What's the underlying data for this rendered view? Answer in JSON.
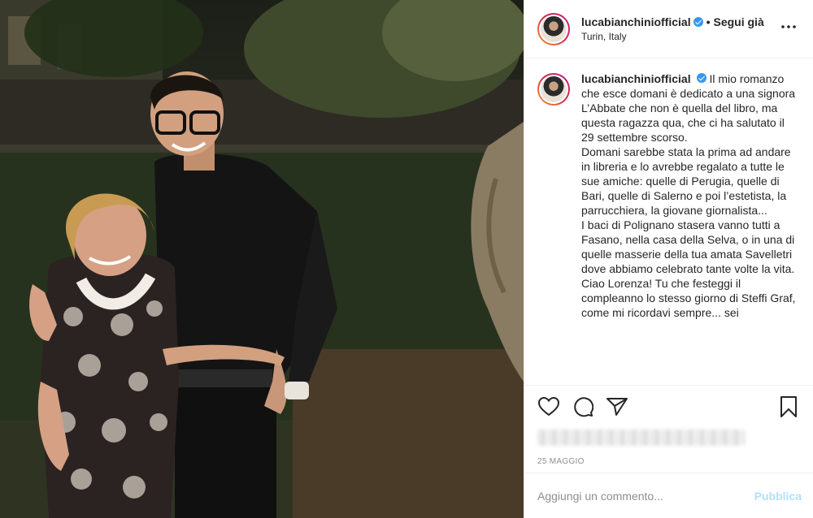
{
  "post": {
    "image_alt": "",
    "author": {
      "username": "lucabianchiniofficial",
      "verified": true,
      "follow_label": "Segui già",
      "separator": "•",
      "location": "Turin, Italy"
    },
    "more_icon": "more-horizontal-icon",
    "caption": {
      "username": "lucabianchiniofficial",
      "paragraphs": [
        "Il mio romanzo che esce domani è dedicato a una signora L’Abbate che non è quella del libro, ma questa ragazza qua, che ci ha salutato il 29 settembre scorso.",
        "Domani sarebbe stata la prima ad andare in libreria e lo avrebbe regalato a tutte le sue amiche: quelle di Perugia, quelle di Bari, quelle di Salerno e poi l’estetista, la parrucchiera, la giovane giornalista...",
        "I baci di Polignano stasera vanno tutti a Fasano, nella casa della Selva, o in una di quelle masserie della tua amata Savelletri dove abbiamo celebrato tante volte la vita.",
        "Ciao Lorenza! Tu che festeggi il compleanno lo stesso giorno di Steffi Graf, come mi ricordavi sempre... sei"
      ]
    },
    "actions": {
      "like_icon": "heart-icon",
      "comment_icon": "comment-icon",
      "share_icon": "send-icon",
      "save_icon": "bookmark-icon"
    },
    "date": "25 MAGGIO",
    "comment_box": {
      "placeholder": "Aggiungi un commento...",
      "publish_label": "Pubblica"
    }
  },
  "colors": {
    "accent_blue": "#3897f0",
    "publish_disabled": "#b2dffc",
    "muted_text": "#8e8e8e",
    "divider": "#efefef"
  }
}
